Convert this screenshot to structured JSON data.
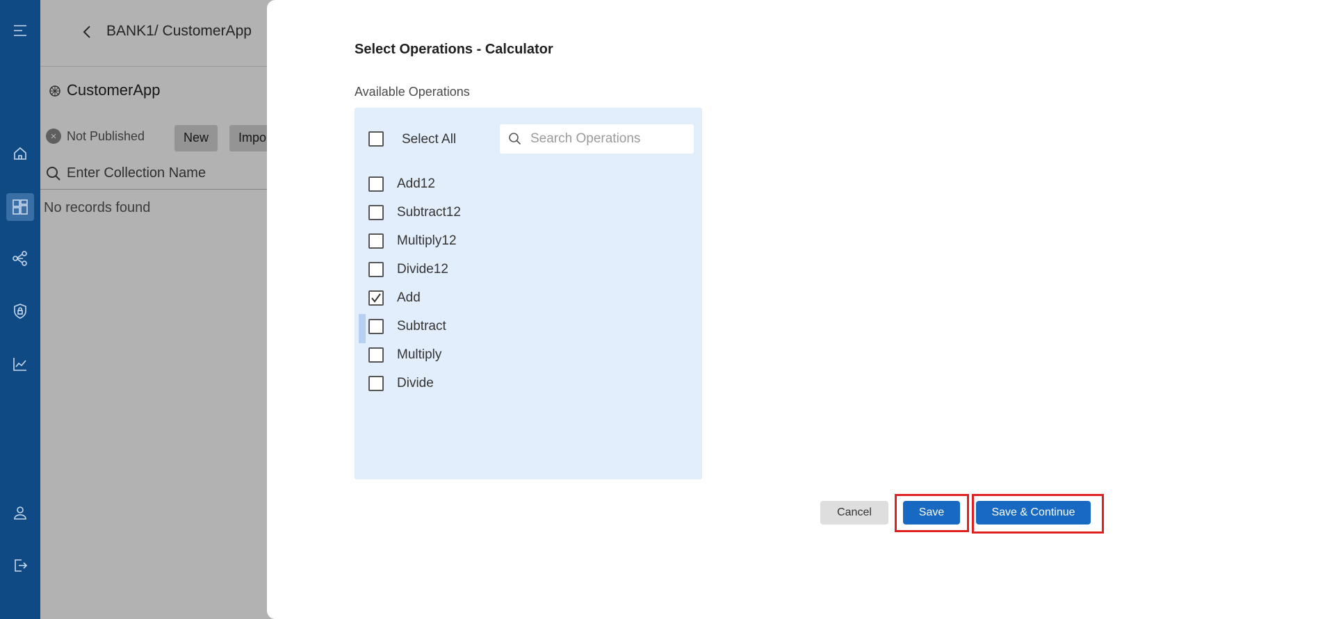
{
  "background": {
    "breadcrumb": "BANK1/ CustomerApp",
    "app_title": "CustomerApp",
    "status_text": "Not Published",
    "buttons": [
      "New",
      "Impo"
    ],
    "search_placeholder": "Enter Collection Name",
    "empty_text": "No records found"
  },
  "nav": {
    "icons": [
      "menu-icon",
      "home-icon",
      "dashboard-icon",
      "share-icon",
      "shield-icon",
      "chart-icon",
      "user-icon",
      "logout-icon"
    ],
    "active": "dashboard-icon"
  },
  "drawer": {
    "title": "Select Operations - Calculator",
    "available_label": "Available Operations",
    "select_all_label": "Select All",
    "search_placeholder": "Search Operations",
    "operations": [
      {
        "label": "Add12",
        "checked": false
      },
      {
        "label": "Subtract12",
        "checked": false
      },
      {
        "label": "Multiply12",
        "checked": false
      },
      {
        "label": "Divide12",
        "checked": false
      },
      {
        "label": "Add",
        "checked": true
      },
      {
        "label": "Subtract",
        "checked": false
      },
      {
        "label": "Multiply",
        "checked": false
      },
      {
        "label": "Divide",
        "checked": false
      }
    ],
    "cancel_label": "Cancel",
    "save_label": "Save",
    "save_continue_label": "Save & Continue"
  },
  "colors": {
    "nav_bg": "#0f4a85",
    "panel_bg": "#e3eefc",
    "primary_button": "#1769c1",
    "highlight_box": "#e02020"
  }
}
